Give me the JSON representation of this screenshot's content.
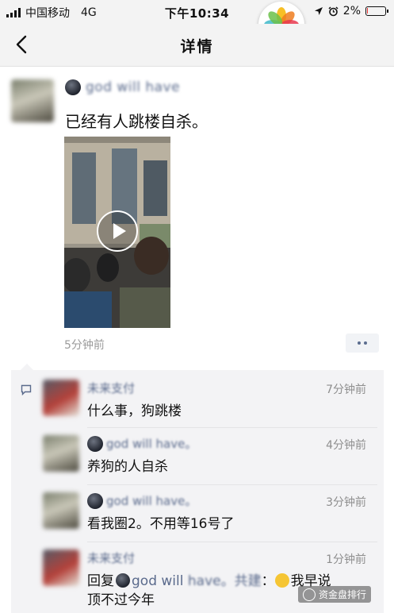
{
  "status_bar": {
    "carrier": "中国移动",
    "network": "4G",
    "time": "下午10:34",
    "battery": "2%"
  },
  "nav": {
    "title": "详情"
  },
  "post": {
    "author": "god will have",
    "text": "已经有人跳楼自杀。",
    "time": "5分钟前"
  },
  "comments": [
    {
      "name": "未来支付",
      "time": "7分钟前",
      "text": "什么事，狗跳楼"
    },
    {
      "name": "god will have。",
      "time": "4分钟前",
      "text": "养狗的人自杀"
    },
    {
      "name": "god will have。",
      "time": "3分钟前",
      "text": "看我圈2。不用等16号了"
    },
    {
      "name": "未来支付",
      "time": "1分钟前",
      "reply_prefix": "回复",
      "reply_to": "god will",
      "reply_suffix": "：",
      "text": "我早说",
      "text2": "顶不过今年"
    }
  ],
  "watermark": {
    "text": "资金盘排行"
  }
}
